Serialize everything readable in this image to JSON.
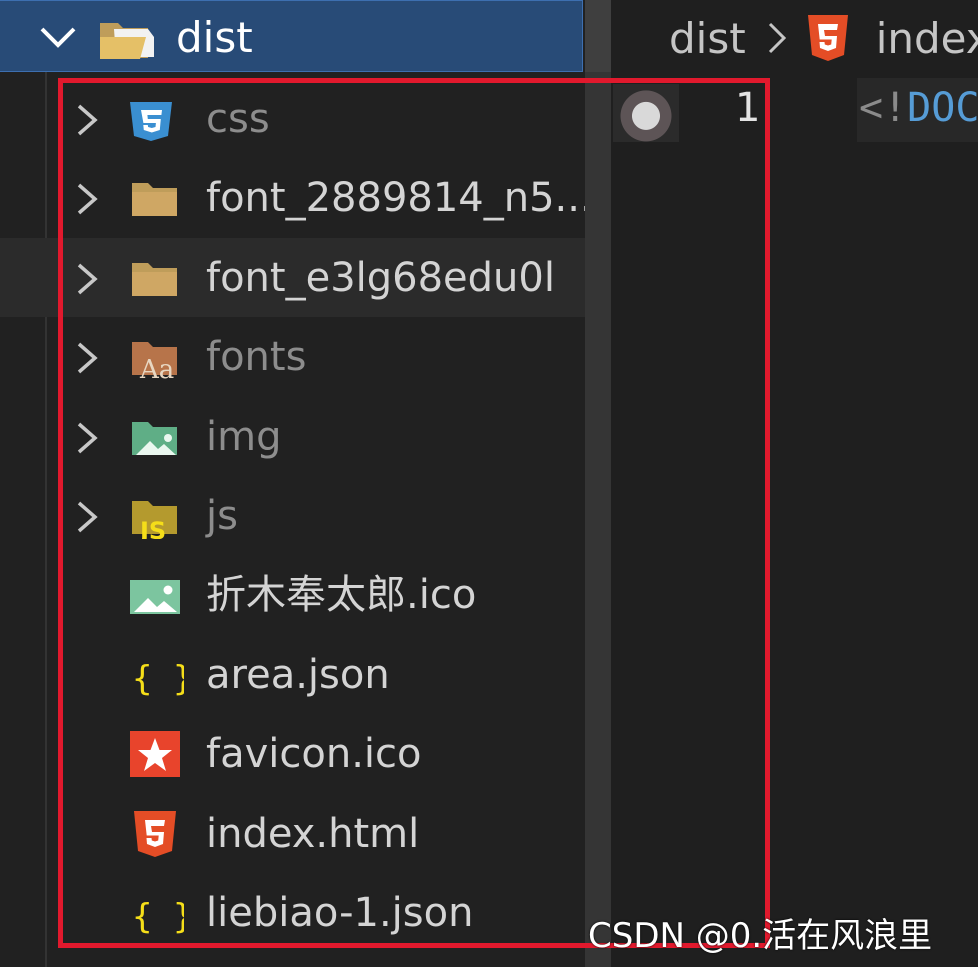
{
  "colors": {
    "explorer_bg": "#212121",
    "header_bg": "#284b77",
    "highlight_box": "#e1192d",
    "html_orange": "#e44d26",
    "json_yellow": "#f5de19",
    "folder_tan": "#bf9d5a",
    "image_green": "#7cc59f",
    "css_blue": "#3a8fd1",
    "favicon_red": "#e8442c"
  },
  "explorer": {
    "folder_name": "dist",
    "folder_icon": "folder-open-icon",
    "items": [
      {
        "label": "css",
        "icon": "css-folder-icon",
        "expandable": true,
        "dim": true
      },
      {
        "label": "font_2889814_n5...",
        "icon": "folder-icon",
        "expandable": true,
        "dim": false
      },
      {
        "label": "font_e3lg68edu0l",
        "icon": "folder-icon",
        "expandable": true,
        "dim": false
      },
      {
        "label": "fonts",
        "icon": "fonts-folder-icon",
        "expandable": true,
        "dim": true
      },
      {
        "label": "img",
        "icon": "image-folder-icon",
        "expandable": true,
        "dim": true
      },
      {
        "label": "js",
        "icon": "js-folder-icon",
        "expandable": true,
        "dim": true
      },
      {
        "label": "折木奉太郎.ico",
        "icon": "image-file-icon",
        "expandable": false,
        "dim": false
      },
      {
        "label": "area.json",
        "icon": "json-icon",
        "expandable": false,
        "dim": false
      },
      {
        "label": "favicon.ico",
        "icon": "favicon-icon",
        "expandable": false,
        "dim": false
      },
      {
        "label": "index.html",
        "icon": "html5-icon",
        "expandable": false,
        "dim": false
      },
      {
        "label": "liebiao-1.json",
        "icon": "json-icon",
        "expandable": false,
        "dim": false
      }
    ]
  },
  "editor": {
    "breadcrumb": {
      "folder": "dist",
      "file": "index"
    },
    "line_number": "1",
    "code": {
      "open": "<!",
      "keyword": "DOC"
    }
  },
  "watermark": "CSDN @0.活在风浪里"
}
